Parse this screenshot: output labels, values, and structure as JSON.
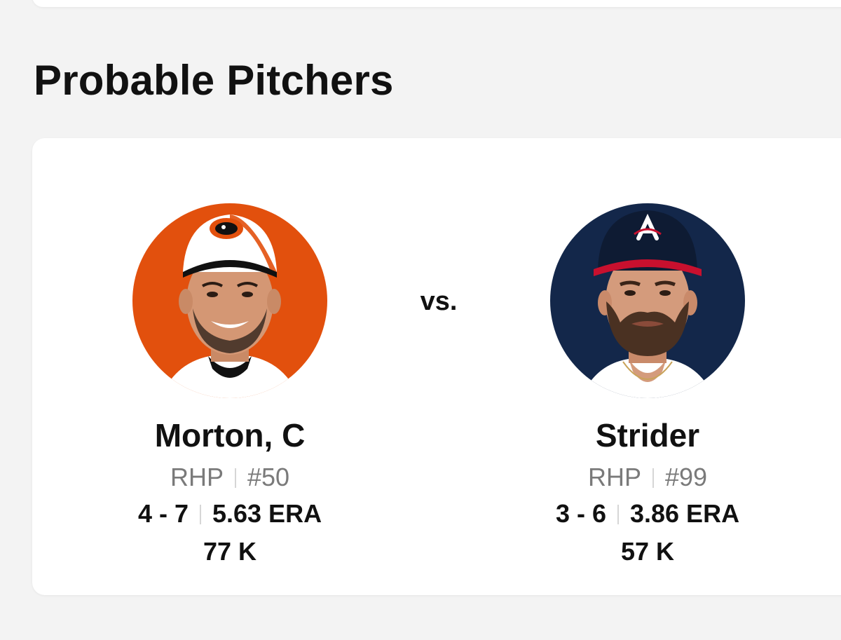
{
  "section": {
    "title": "Probable Pitchers"
  },
  "matchup": {
    "vs_label": "vs."
  },
  "pitchers": [
    {
      "name": "Morton, C",
      "throws": "RHP",
      "number": "#50",
      "record": "4 - 7",
      "era": "5.63 ERA",
      "strikeouts": "77 K",
      "photo_bg": "#e2500d",
      "cap_color": "#ffffff",
      "cap_brim": "#111111",
      "cap_logo": "oriole-bird-logo"
    },
    {
      "name": "Strider",
      "throws": "RHP",
      "number": "#99",
      "record": "3 - 6",
      "era": "3.86 ERA",
      "strikeouts": "57 K",
      "photo_bg": "#13274a",
      "cap_color": "#13274a",
      "cap_brim": "#c8102e",
      "cap_logo": "braves-a-logo"
    }
  ]
}
